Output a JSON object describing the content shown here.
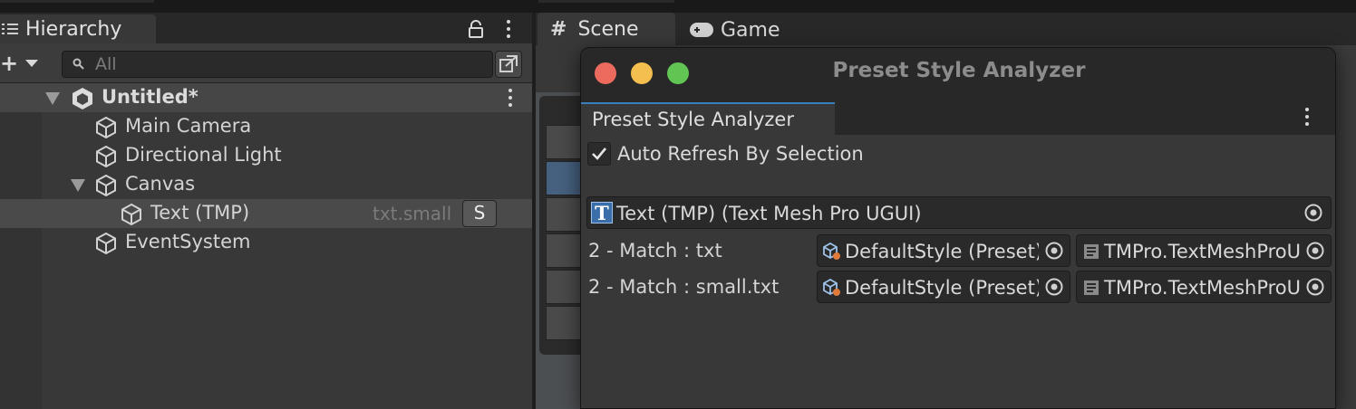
{
  "hierarchy": {
    "title": "Hierarchy",
    "search_placeholder": "All",
    "scene_name": "Untitled*",
    "items": [
      {
        "label": "Main Camera"
      },
      {
        "label": "Directional Light"
      },
      {
        "label": "Canvas"
      },
      {
        "label": "Text (TMP)",
        "style_tag": "txt.small",
        "badge": "S"
      },
      {
        "label": "EventSystem"
      }
    ]
  },
  "scene": {
    "tabs": [
      {
        "label": "Scene"
      },
      {
        "label": "Game"
      }
    ]
  },
  "analyzer": {
    "window_title": "Preset Style Analyzer",
    "tab_label": "Preset Style Analyzer",
    "auto_refresh_label": "Auto Refresh By Selection",
    "auto_refresh_checked": true,
    "target_object": "Text (TMP) (Text Mesh Pro UGUI)",
    "matches": [
      {
        "label": "2 - Match : txt",
        "preset": "DefaultStyle (Preset)",
        "type": "TMPro.TextMeshProUGUI"
      },
      {
        "label": "2 - Match : small.txt",
        "preset": "DefaultStyle (Preset)",
        "type": "TMPro.TextMeshProUGUI"
      }
    ]
  },
  "colors": {
    "panel_bg": "#383838",
    "selection": "#4a4a4a",
    "accent": "#3c7fbf",
    "traffic_red": "#ed6a5e",
    "traffic_yellow": "#f4bf4f",
    "traffic_green": "#61c554"
  }
}
